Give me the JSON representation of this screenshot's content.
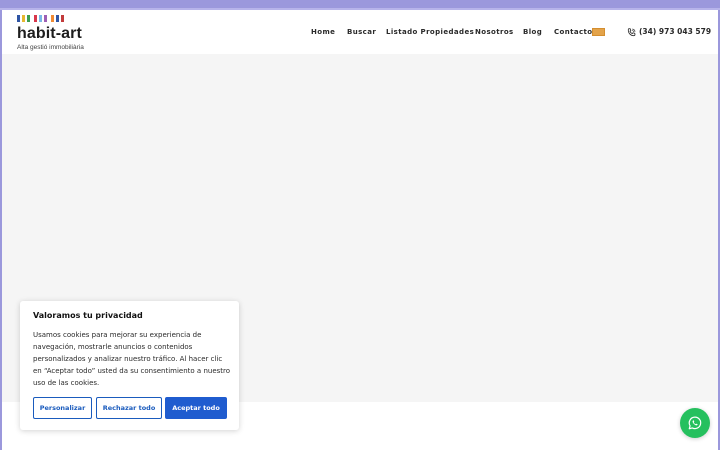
{
  "brand": {
    "name": "habit-art",
    "tagline": "Alta gestió immobiliària",
    "bar_colors": [
      "#2f55a4",
      "#e6b730",
      "#3c9e4f",
      "#d9364b",
      "#7ab8e8",
      "#9d5fb5",
      "#f08a34",
      "#2f55a4",
      "#c23b3b"
    ]
  },
  "nav": {
    "items": [
      "Home",
      "Buscar",
      "Listado Propiedades",
      "Nosotros",
      "Blog",
      "Contacto"
    ],
    "language_flag": "flag-icon",
    "phone": "(34) 973 043 579",
    "phone_icon": "phone-icon"
  },
  "cookie_banner": {
    "title": "Valoramos tu privacidad",
    "body": "Usamos cookies para mejorar su experiencia de navegación, mostrarle anuncios o contenidos personalizados y analizar nuestro tráfico. Al hacer clic en “Aceptar todo” usted da su consentimiento a nuestro uso de las cookies.",
    "buttons": {
      "customize": "Personalizar",
      "reject": "Rechazar todo",
      "accept": "Aceptar todo"
    }
  },
  "whatsapp": {
    "icon": "whatsapp-icon",
    "color": "#25c05e"
  },
  "colors": {
    "accent": "#1f5ccf",
    "frame": "#9b98dc"
  }
}
